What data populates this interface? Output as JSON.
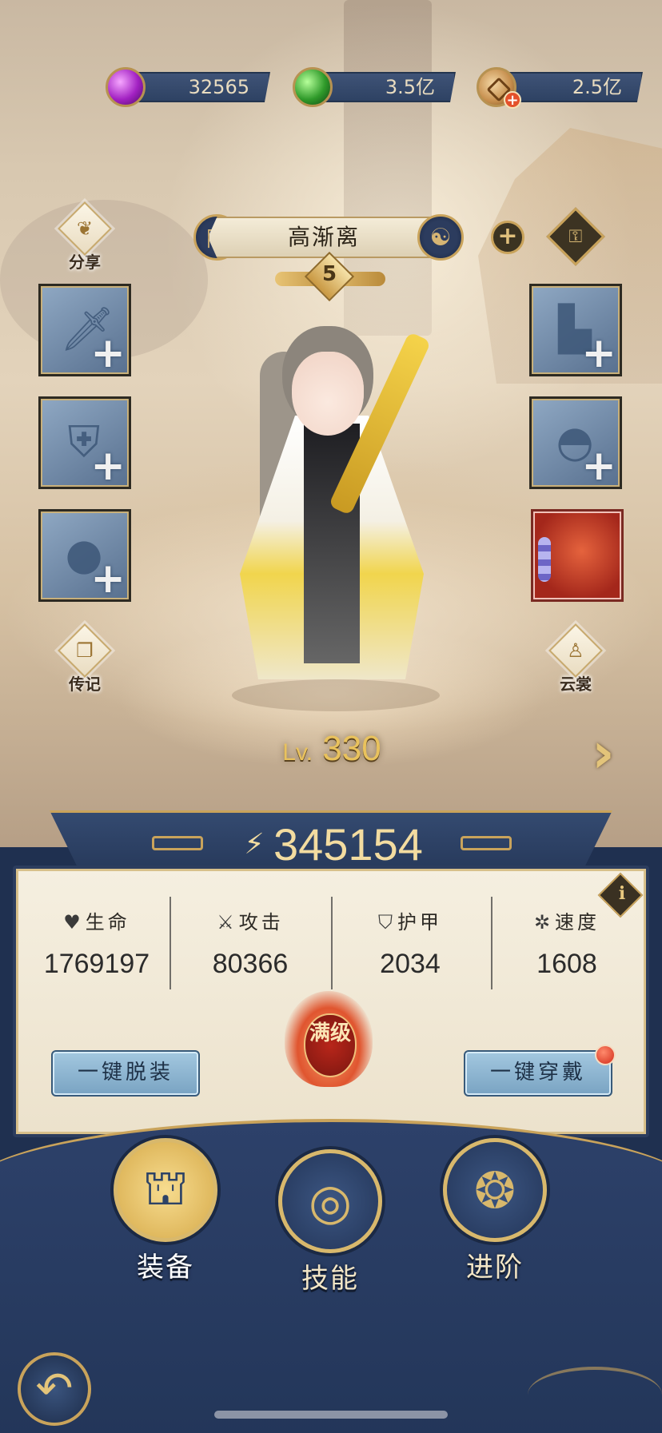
{
  "currencies": [
    {
      "value": "32565",
      "icon": "purple-gem-icon"
    },
    {
      "value": "3.5亿",
      "icon": "green-jade-icon"
    },
    {
      "value": "2.5亿",
      "icon": "copper-coin-icon"
    }
  ],
  "side_buttons": {
    "share": "分享",
    "biography": "传记",
    "outfit": "云裳"
  },
  "hero": {
    "yang_badge": "陽",
    "name": "高渐离",
    "star_level": "5",
    "level_prefix": "Lv.",
    "level": "330"
  },
  "power": "345154",
  "stats": [
    {
      "icon": "heart-icon",
      "glyph": "♥",
      "label": "生命",
      "value": "1769197"
    },
    {
      "icon": "crossed-swords-icon",
      "glyph": "⚔",
      "label": "攻击",
      "value": "80366"
    },
    {
      "icon": "shield-icon",
      "glyph": "⛉",
      "label": "护甲",
      "value": "2034"
    },
    {
      "icon": "swirl-speed-icon",
      "glyph": "✲",
      "label": "速度",
      "value": "1608"
    }
  ],
  "info_glyph": "i",
  "buttons": {
    "unequip_all": "一键脱装",
    "equip_all": "一键穿戴"
  },
  "maxed_badge": "满级",
  "nav": {
    "equip": "装备",
    "skills": "技能",
    "advance": "进阶"
  },
  "colors": {
    "navy": "#2d416a",
    "gold": "#c9a35b",
    "parchment": "#f5efe0",
    "button_blue": "#a3c8e0"
  }
}
